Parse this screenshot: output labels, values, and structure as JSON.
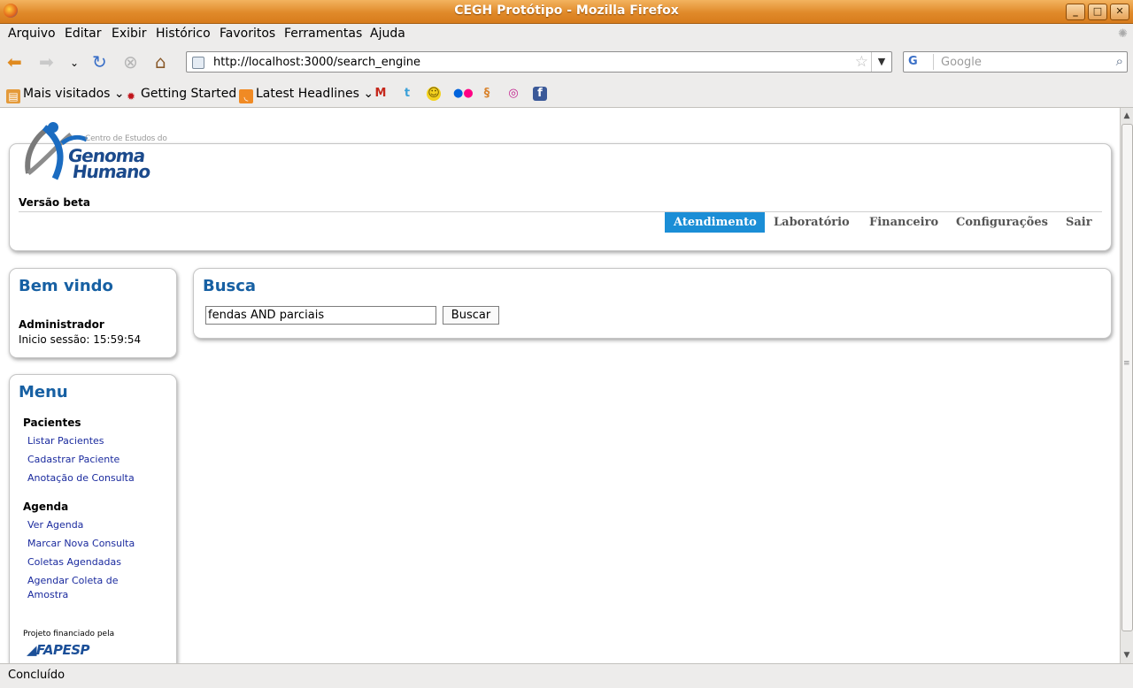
{
  "window": {
    "title": "CEGH Protótipo - Mozilla Firefox",
    "minimize": "_",
    "maximize": "□",
    "close": "✕"
  },
  "menu": [
    "Arquivo",
    "Editar",
    "Exibir",
    "Histórico",
    "Favoritos",
    "Ferramentas",
    "Ajuda"
  ],
  "nav": {
    "url": "http://localhost:3000/search_engine",
    "search_placeholder": "Google",
    "search_engine": "G"
  },
  "bookmarks": {
    "most_visited": "Mais visitados",
    "getting_started": "Getting Started",
    "latest_headlines": "Latest Headlines",
    "icons": [
      "gmail-icon",
      "twitter-icon",
      "smiley-icon",
      "flickr-icon",
      "delicious-icon",
      "orkut-icon",
      "facebook-icon"
    ]
  },
  "header": {
    "logo_small": "Centro de Estudos do",
    "logo_line1": "Genoma",
    "logo_line2": "Humano",
    "version": "Versão beta",
    "tabs": [
      "Atendimento",
      "Laboratório",
      "Financeiro",
      "Configurações",
      "Sair"
    ],
    "active_tab": "Atendimento"
  },
  "welcome": {
    "title": "Bem vindo",
    "user": "Administrador",
    "session": "Inicio sessão: 15:59:54"
  },
  "sidemenu": {
    "title": "Menu",
    "sections": [
      {
        "title": "Pacientes",
        "links": [
          "Listar Pacientes",
          "Cadastrar Paciente",
          "Anotação de Consulta"
        ]
      },
      {
        "title": "Agenda",
        "links": [
          "Ver Agenda",
          "Marcar Nova Consulta",
          "Coletas Agendadas",
          "Agendar Coleta de Amostra"
        ]
      }
    ],
    "financed_by": "Projeto financiado pela",
    "sponsor": "FAPESP"
  },
  "search": {
    "title": "Busca",
    "query": "fendas AND parciais",
    "button": "Buscar"
  },
  "status": "Concluído",
  "colors": {
    "titlebar": "#e08a2a",
    "accent_blue": "#1b8ed6",
    "heading_blue": "#1760a3",
    "link_blue": "#1a2a9e"
  }
}
